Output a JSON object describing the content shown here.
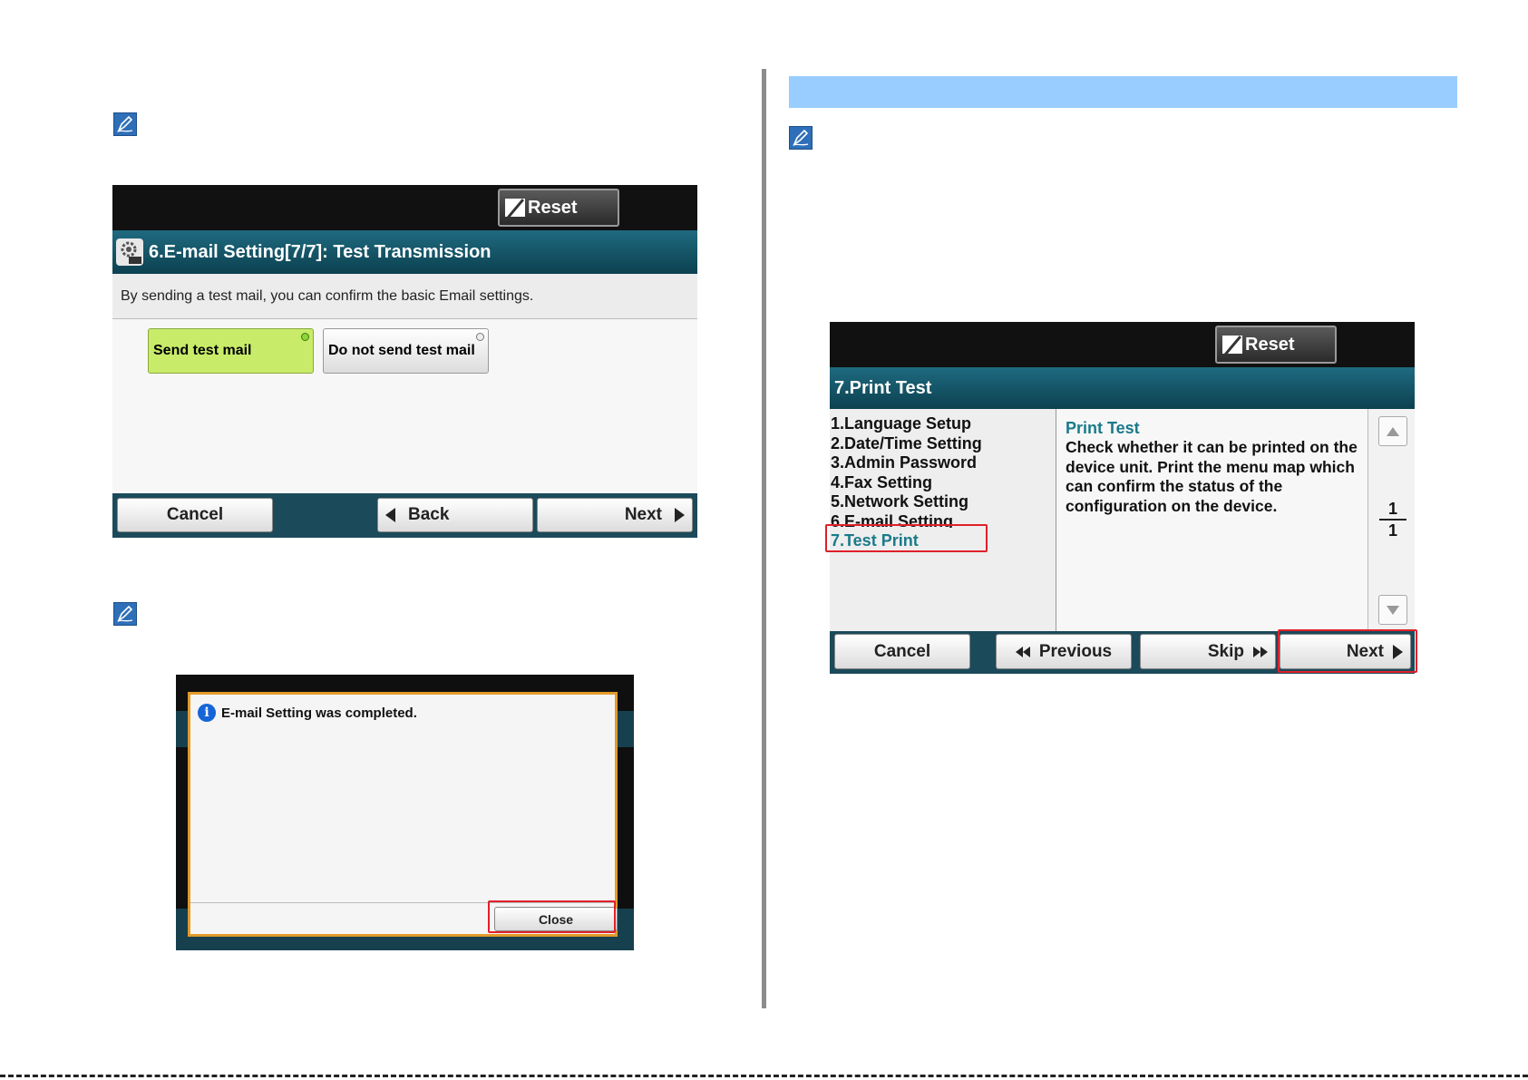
{
  "left_screen": {
    "reset_label": "Reset",
    "title": "6.E-mail Setting[7/7]: Test Transmission",
    "description": "By sending a test mail, you can confirm the basic Email settings.",
    "option_send": "Send test mail",
    "option_not_send": "Do not send test mail",
    "cancel_label": "Cancel",
    "back_label": "Back",
    "next_label": "Next"
  },
  "dialog": {
    "message": "E-mail Setting was completed.",
    "close_label": "Close"
  },
  "right_screen": {
    "reset_label": "Reset",
    "title": "7.Print Test",
    "menu_items": [
      "1.Language Setup",
      "2.Date/Time Setting",
      "3.Admin Password",
      "4.Fax Setting",
      "5.Network Setting",
      "6.E-mail Setting",
      "7.Test Print"
    ],
    "detail_title": "Print Test",
    "detail_text": "Check whether it can be printed on the device unit. Print the menu map which can confirm the status of the configuration on the device.",
    "page_current": "1",
    "page_total": "1",
    "cancel_label": "Cancel",
    "previous_label": "Previous",
    "skip_label": "Skip",
    "next_label": "Next"
  },
  "colors": {
    "accent_band": "#99ccff",
    "selected_option": "#c8ec6a",
    "highlight_red": "#e0202a",
    "menu_selected": "#1a7a8a"
  }
}
